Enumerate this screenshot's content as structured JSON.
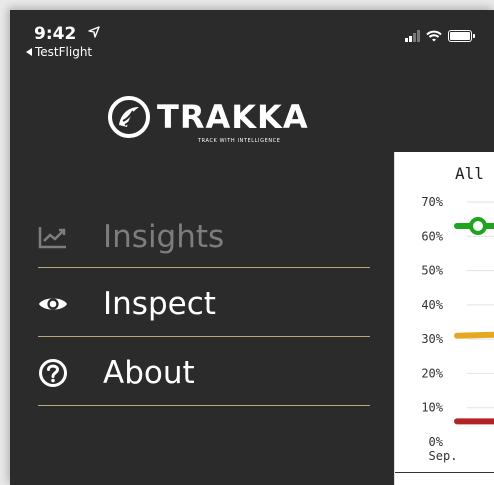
{
  "status_bar": {
    "time": "9:42",
    "back_label": "TestFlight"
  },
  "logo": {
    "name": "TRAKKA",
    "tagline": "TRACK WITH INTELLIGENCE"
  },
  "menu": {
    "items": [
      {
        "label": "Insights",
        "icon": "chart-line-icon",
        "active": false
      },
      {
        "label": "Inspect",
        "icon": "eye-icon",
        "active": true
      },
      {
        "label": "About",
        "icon": "question-circle-icon",
        "active": true
      }
    ]
  },
  "colors": {
    "background": "#2b2b2b",
    "divider": "#b8a77a",
    "green": "#1ea51e",
    "amber": "#e6a823",
    "red": "#b52323"
  },
  "chart_data": {
    "type": "line",
    "title": "All I",
    "y_ticks": [
      "70%",
      "60%",
      "50%",
      "40%",
      "30%",
      "20%",
      "10%",
      "0%"
    ],
    "ylim": [
      0,
      70
    ],
    "x_ticks": [
      "Sep."
    ],
    "series": [
      {
        "color": "#1ea51e",
        "values": [
          63
        ]
      },
      {
        "color": "#e6a823",
        "values": [
          31
        ]
      },
      {
        "color": "#b52323",
        "values": [
          6
        ]
      }
    ]
  }
}
